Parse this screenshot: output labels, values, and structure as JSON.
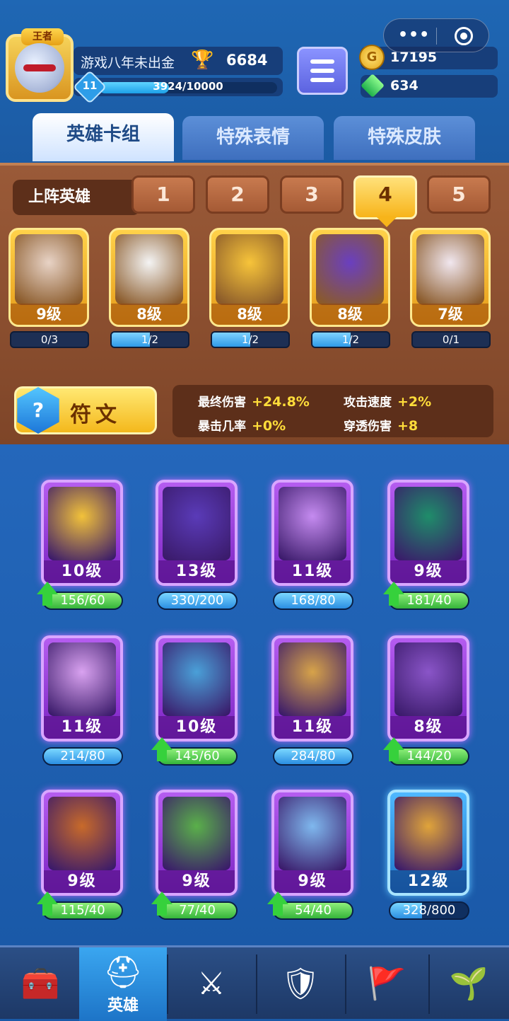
{
  "header": {
    "badge_text": "王者",
    "player_name": "游戏八年未出金",
    "trophies": "6684",
    "level": "11",
    "xp_text": "3924/10000",
    "xp_progress": 0.3924,
    "coins": "17195",
    "gems": "634"
  },
  "tabs": [
    {
      "label": "英雄卡组"
    },
    {
      "label": "特殊表情"
    },
    {
      "label": "特殊皮肤"
    }
  ],
  "lineup": {
    "label": "上阵英雄",
    "slots": [
      "1",
      "2",
      "3",
      "4",
      "5"
    ],
    "selected_slot": "4",
    "heroes": [
      {
        "level": "9级",
        "progress": "0/3",
        "ratio": 0,
        "color": "#e8d3c6"
      },
      {
        "level": "8级",
        "progress": "1/2",
        "ratio": 0.5,
        "color": "#f4f4f4"
      },
      {
        "level": "8级",
        "progress": "1/2",
        "ratio": 0.5,
        "color": "#f7c43a"
      },
      {
        "level": "8级",
        "progress": "1/2",
        "ratio": 0.5,
        "color": "#6a3fc0"
      },
      {
        "level": "7级",
        "progress": "0/1",
        "ratio": 0,
        "color": "#f1e7ef"
      }
    ],
    "rune_label": "符文",
    "stats": [
      {
        "name": "最终伤害",
        "value": "+24.8%"
      },
      {
        "name": "攻击速度",
        "value": "+2%"
      },
      {
        "name": "暴击几率",
        "value": "+0%"
      },
      {
        "name": "穿透伤害",
        "value": "+8"
      }
    ]
  },
  "cards": [
    {
      "level": "10级",
      "progress": "156/60",
      "ratio": 1,
      "upgrade": true,
      "color": "#f2c23a",
      "frame": "purple"
    },
    {
      "level": "13级",
      "progress": "330/200",
      "ratio": 1,
      "upgrade": false,
      "color": "#5a3bb8",
      "frame": "purple"
    },
    {
      "level": "11级",
      "progress": "168/80",
      "ratio": 1,
      "upgrade": false,
      "color": "#c58bf0",
      "frame": "purple"
    },
    {
      "level": "9级",
      "progress": "181/40",
      "ratio": 1,
      "upgrade": true,
      "color": "#1f8d6a",
      "frame": "purple"
    },
    {
      "level": "11级",
      "progress": "214/80",
      "ratio": 1,
      "upgrade": false,
      "color": "#d9a2f0",
      "frame": "purple"
    },
    {
      "level": "10级",
      "progress": "145/60",
      "ratio": 1,
      "upgrade": true,
      "color": "#4aa0d8",
      "frame": "purple"
    },
    {
      "level": "11级",
      "progress": "284/80",
      "ratio": 1,
      "upgrade": false,
      "color": "#d7a349",
      "frame": "purple"
    },
    {
      "level": "8级",
      "progress": "144/20",
      "ratio": 1,
      "upgrade": true,
      "color": "#8a55c8",
      "frame": "purple"
    },
    {
      "level": "9级",
      "progress": "115/40",
      "ratio": 1,
      "upgrade": true,
      "color": "#c86a2a",
      "frame": "purple"
    },
    {
      "level": "9级",
      "progress": "77/40",
      "ratio": 1,
      "upgrade": true,
      "color": "#5ab04a",
      "frame": "purple"
    },
    {
      "level": "9级",
      "progress": "54/40",
      "ratio": 1,
      "upgrade": true,
      "color": "#7fb8ee",
      "frame": "purple"
    },
    {
      "level": "12级",
      "progress": "328/800",
      "ratio": 0.41,
      "upgrade": false,
      "color": "#e0a43a",
      "frame": "blue"
    }
  ],
  "nav": {
    "items": [
      {
        "icon": "treasure-chest-icon",
        "label": ""
      },
      {
        "icon": "knight-helmet-icon",
        "label": "英雄"
      },
      {
        "icon": "crossed-swords-icon",
        "label": ""
      },
      {
        "icon": "crown-shield-icon",
        "label": ""
      },
      {
        "icon": "guild-banner-icon",
        "label": ""
      },
      {
        "icon": "sprout-island-icon",
        "label": ""
      }
    ],
    "active_index": 1
  }
}
